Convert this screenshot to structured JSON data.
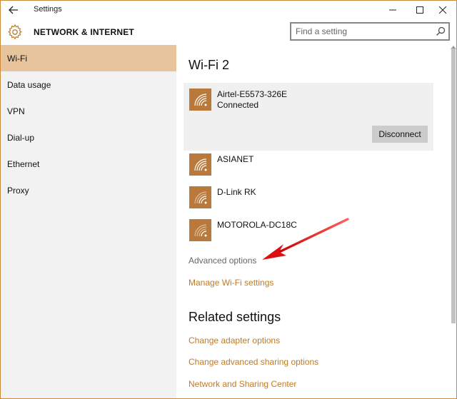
{
  "window": {
    "title": "Settings"
  },
  "header": {
    "title": "NETWORK & INTERNET",
    "search_placeholder": "Find a setting"
  },
  "sidebar": {
    "items": [
      {
        "label": "Wi-Fi",
        "selected": true
      },
      {
        "label": "Data usage",
        "selected": false
      },
      {
        "label": "VPN",
        "selected": false
      },
      {
        "label": "Dial-up",
        "selected": false
      },
      {
        "label": "Ethernet",
        "selected": false
      },
      {
        "label": "Proxy",
        "selected": false
      }
    ]
  },
  "main": {
    "section_title": "Wi-Fi 2",
    "connected_network": {
      "name": "Airtel-E5573-326E",
      "status": "Connected",
      "disconnect_label": "Disconnect"
    },
    "networks": [
      {
        "name": "ASIANET"
      },
      {
        "name": "D-Link RK"
      },
      {
        "name": "MOTOROLA-DC18C"
      }
    ],
    "advanced_options": "Advanced options",
    "manage_wifi": "Manage Wi-Fi settings",
    "related_title": "Related settings",
    "related_links": [
      "Change adapter options",
      "Change advanced sharing options",
      "Network and Sharing Center"
    ]
  },
  "colors": {
    "accent": "#c07a24",
    "wifi_tile": "#b8793a",
    "sidebar_selected": "#e8c49c",
    "annotation_arrow": "#e01010"
  }
}
